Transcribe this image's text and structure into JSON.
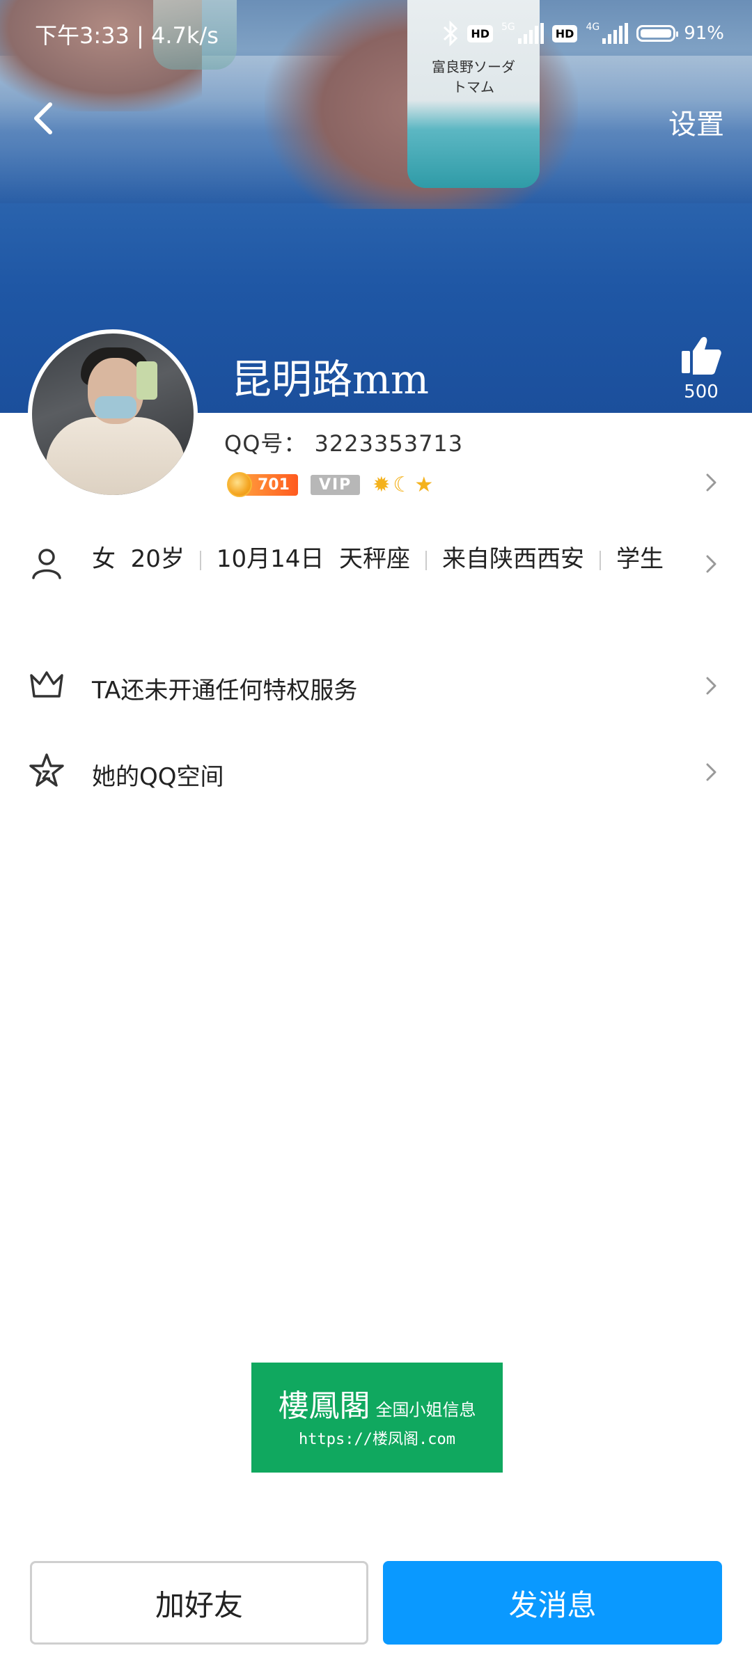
{
  "status_bar": {
    "time": "下午3:33 | 4.7k/s",
    "hd1": "HD",
    "gen1": "5G",
    "hd2": "HD",
    "gen2": "4G",
    "battery_pct": "91%"
  },
  "nav": {
    "back_icon": "chevron-left-icon",
    "settings_label": "设置"
  },
  "cover": {
    "bottle_label": "富良野ソーダ トマム"
  },
  "profile": {
    "nickname": "昆明路mm",
    "like_count": "500",
    "qq_number": "QQ号： 3223353713",
    "level": "701",
    "vip_label": "VIP",
    "level_icons": [
      "sun-icon",
      "moon-icon",
      "star-icon"
    ]
  },
  "details": {
    "gender": "女",
    "age": "20岁",
    "birthday": "10月14日",
    "zodiac": "天秤座",
    "location": "来自陕西西安",
    "occupation": "学生"
  },
  "rows": {
    "vip_service": "TA还未开通任何特权服务",
    "qzone": "她的QQ空间"
  },
  "ad": {
    "title": "樓鳳閣",
    "subtitle": "全国小姐信息",
    "url": "https://楼凤阁.com"
  },
  "buttons": {
    "add_friend": "加好友",
    "send_message": "发消息"
  },
  "colors": {
    "primary_blue": "#0a99ff",
    "ad_green": "#10a85f",
    "level_orange": "#ff5a1f",
    "vip_gray": "#b7b7b7"
  }
}
